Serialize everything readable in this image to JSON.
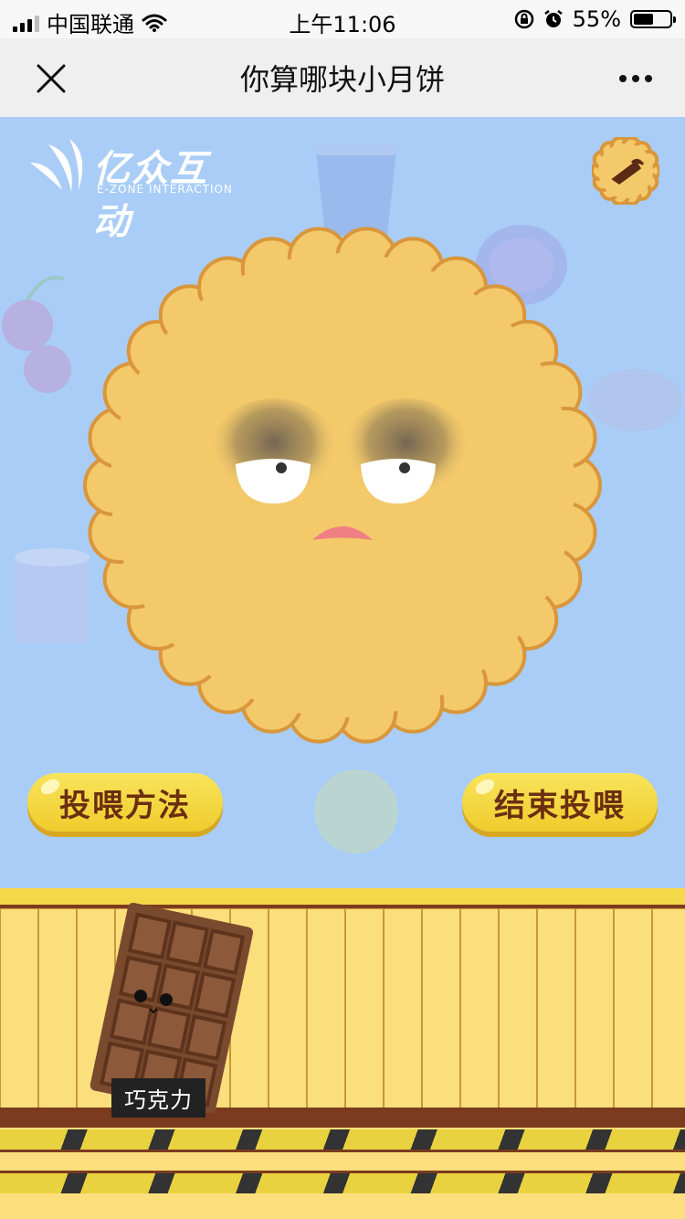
{
  "status_bar": {
    "carrier": "中国联通",
    "time": "上午11:06",
    "battery_percent": "55%",
    "battery_level": 0.55
  },
  "nav": {
    "title": "你算哪块小月饼",
    "close_icon": "close-icon",
    "more_icon": "more-icon"
  },
  "game": {
    "logo": {
      "name": "亿众互动",
      "subtitle": "E-ZONE INTERACTION"
    },
    "buttons": {
      "feed_method": "投喂方法",
      "end_feeding": "结束投喂"
    },
    "item": {
      "label": "巧克力"
    },
    "colors": {
      "sky": "#a9cdf7",
      "mooncake": "#f3c96a",
      "button": "#f3d43b",
      "button_text": "#6b2e10",
      "fence": "#fbdf7c",
      "fence_dark": "#7b3b1e"
    }
  }
}
